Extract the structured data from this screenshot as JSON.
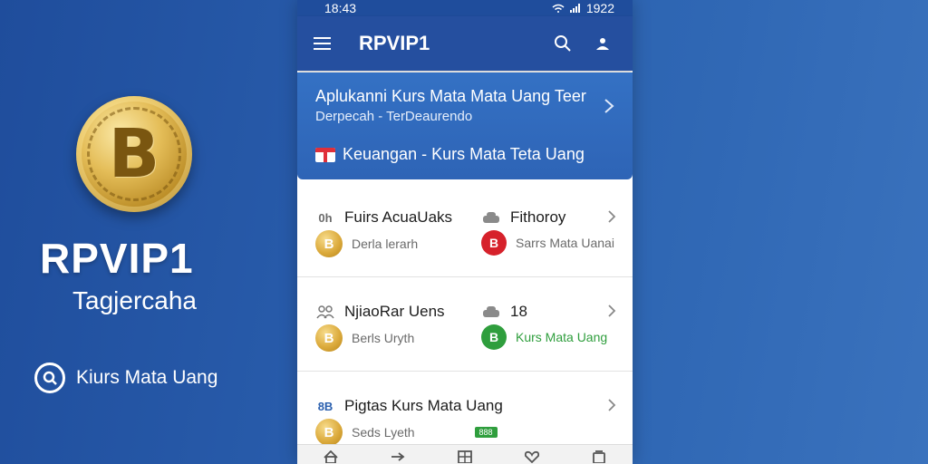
{
  "promo": {
    "brand": "RPVIP1",
    "tagline": "Tagjercaha",
    "link_label": "Kiurs Mata Uang",
    "coin_glyph": "B"
  },
  "status": {
    "time": "18:43",
    "battery": "1922"
  },
  "app_bar": {
    "title": "RPVIP1"
  },
  "banner": {
    "title": "Aplukanni Kurs Mata Mata Uang Teer",
    "subtitle": "Derpecah - TerDeaurendo",
    "line": "Keuangan - Kurs Mata Teta Uang"
  },
  "cards": [
    {
      "left_top_icon": "0h",
      "left_top": "Fuirs AcuaUaks",
      "left_bot_badge": "B",
      "left_bot": "Derla lerarh",
      "right_top": "Fithoroy",
      "right_bot_badge": "B",
      "right_bot": "Sarrs Mata Uanai"
    },
    {
      "left_top_icon": "",
      "left_top": "NjiaoRar Uens",
      "left_bot_badge": "B",
      "left_bot": "Berls Uryth",
      "right_top": "18",
      "right_bot_badge": "B",
      "right_bot": "Kurs Mata Uang"
    },
    {
      "left_top_icon": "8B",
      "left_top": "Pigtas Kurs Mata Uang",
      "left_bot_badge": "B",
      "left_bot": "Seds Lyeth",
      "right_pill": "888"
    }
  ],
  "colors": {
    "background": "#2a5fae",
    "app_bar": "#254f9f",
    "banner": "#3471c4",
    "accent_red": "#d6212b",
    "accent_green": "#2f9e3d",
    "gold": "#dcab3d"
  },
  "icons": {
    "menu": "hamburger-menu-icon",
    "search": "search-icon",
    "profile": "user-icon",
    "chevron": "chevron-right-icon",
    "nav": [
      "home-icon",
      "arrow-right-icon",
      "grid-icon",
      "heart-icon",
      "wallet-icon"
    ]
  }
}
